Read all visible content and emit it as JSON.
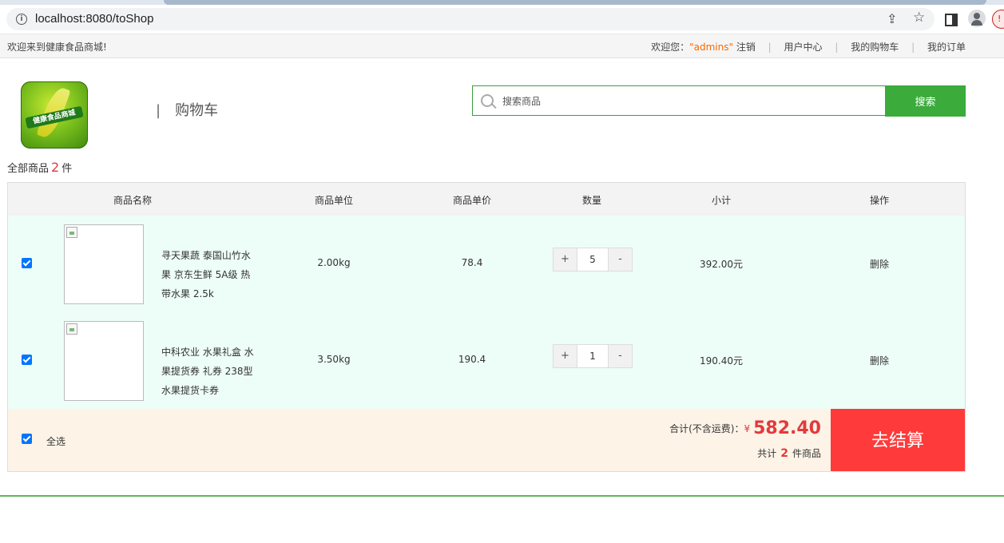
{
  "browser": {
    "url": "localhost:8080/toShop",
    "update_badge": "!"
  },
  "topbar": {
    "welcome": "欢迎来到健康食品商城!",
    "greeting_prefix": "欢迎您：",
    "username": "\"admins\"",
    "logout": "注销",
    "user_center": "用户中心",
    "my_cart": "我的购物车",
    "my_orders": "我的订单",
    "separator": "|"
  },
  "header": {
    "logo_text": "健康食品商城",
    "heading_bar": "|",
    "heading": "购物车"
  },
  "search": {
    "placeholder": "搜索商品",
    "button": "搜索"
  },
  "summary": {
    "prefix": "全部商品",
    "count": "2",
    "suffix": "件"
  },
  "table": {
    "headers": [
      "商品名称",
      "商品单位",
      "商品单价",
      "数量",
      "小计",
      "操作"
    ],
    "rows": [
      {
        "checked": true,
        "name": "寻天果蔬 泰国山竹水果 京东生鲜 5A级 热带水果 2.5k",
        "unit": "2.00kg",
        "price": "78.4",
        "quantity": "5",
        "subtotal": "392.00元",
        "action": "删除"
      },
      {
        "checked": true,
        "name": "中科农业 水果礼盒 水果提货券 礼券 238型 水果提货卡券",
        "unit": "3.50kg",
        "price": "190.4",
        "quantity": "1",
        "subtotal": "190.40元",
        "action": "删除"
      }
    ],
    "stepper_plus": "+",
    "stepper_minus": "-"
  },
  "footer": {
    "select_all": "全选",
    "total_label": "合计(不含运费)：",
    "currency": "¥",
    "total": "582.40",
    "count_prefix": "共计",
    "count": "2",
    "count_suffix": "件商品",
    "checkout": "去结算"
  },
  "colors": {
    "accent_green": "#3bab3b",
    "price_red": "#e4393c",
    "checkout_red": "#ff3a3a",
    "row_bg": "#edfdf7",
    "footer_bg": "#fdf3e7"
  }
}
